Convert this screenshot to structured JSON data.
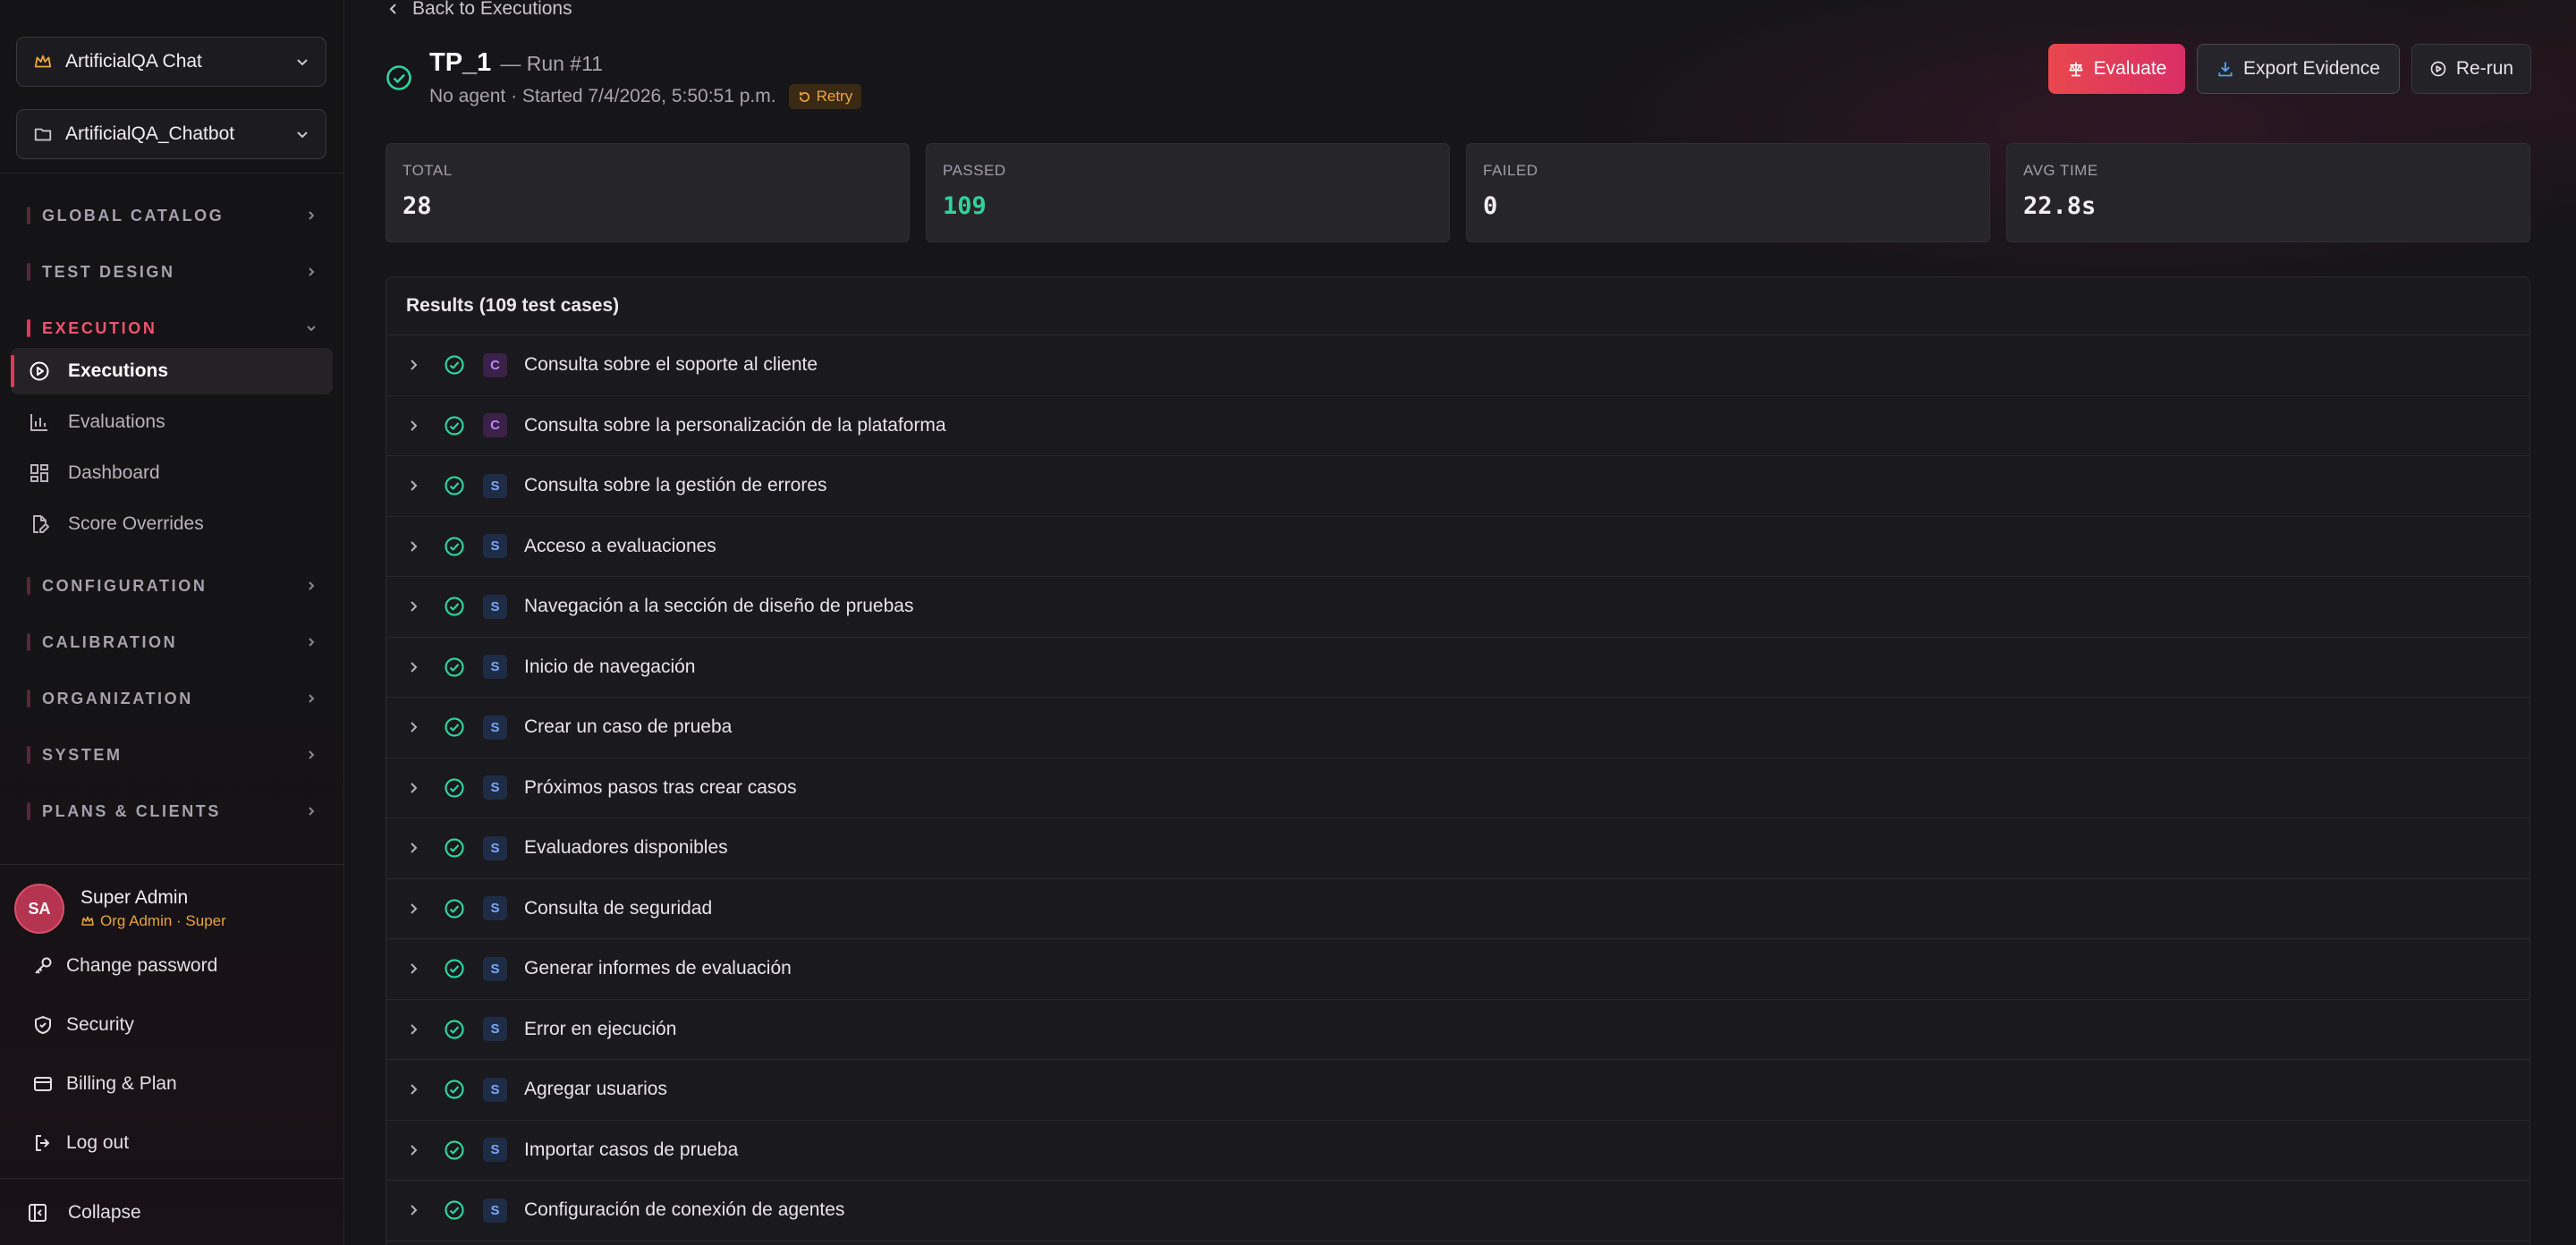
{
  "sidebar": {
    "org_selector": {
      "label": "ArtificialQA Chat",
      "icon": "crown-icon"
    },
    "project_selector": {
      "label": "ArtificialQA_Chatbot",
      "icon": "folder-icon"
    },
    "sections": [
      {
        "label": "GLOBAL CATALOG"
      },
      {
        "label": "TEST DESIGN"
      },
      {
        "label": "EXECUTION"
      },
      {
        "label": "CONFIGURATION"
      },
      {
        "label": "CALIBRATION"
      },
      {
        "label": "ORGANIZATION"
      },
      {
        "label": "SYSTEM"
      },
      {
        "label": "PLANS & CLIENTS"
      }
    ],
    "execution_items": [
      {
        "label": "Executions",
        "icon": "play-circle-icon"
      },
      {
        "label": "Evaluations",
        "icon": "bar-chart-icon"
      },
      {
        "label": "Dashboard",
        "icon": "grid-icon"
      },
      {
        "label": "Score Overrides",
        "icon": "file-edit-icon"
      }
    ],
    "user": {
      "initials": "SA",
      "name": "Super Admin",
      "role": "Org Admin · Super"
    },
    "account_items": [
      {
        "label": "Change password",
        "icon": "key-icon"
      },
      {
        "label": "Security",
        "icon": "shield-icon"
      },
      {
        "label": "Billing & Plan",
        "icon": "credit-card-icon"
      },
      {
        "label": "Log out",
        "icon": "logout-icon"
      }
    ],
    "collapse_label": "Collapse"
  },
  "header": {
    "back_label": "Back to Executions",
    "run_name": "TP_1",
    "run_number": "— Run #11",
    "meta": "No agent · Started 7/4/2026, 5:50:51 p.m.",
    "retry_badge": "Retry",
    "buttons": {
      "evaluate": "Evaluate",
      "export": "Export Evidence",
      "rerun": "Re-run"
    }
  },
  "stats": [
    {
      "label": "TOTAL",
      "value": "28"
    },
    {
      "label": "PASSED",
      "value": "109"
    },
    {
      "label": "FAILED",
      "value": "0"
    },
    {
      "label": "AVG TIME",
      "value": "22.8s"
    }
  ],
  "results": {
    "title": "Results (109 test cases)",
    "rows": [
      {
        "type": "C",
        "label": "Consulta sobre el soporte al cliente"
      },
      {
        "type": "C",
        "label": "Consulta sobre la personalización de la plataforma"
      },
      {
        "type": "S",
        "label": "Consulta sobre la gestión de errores"
      },
      {
        "type": "S",
        "label": "Acceso a evaluaciones"
      },
      {
        "type": "S",
        "label": "Navegación a la sección de diseño de pruebas"
      },
      {
        "type": "S",
        "label": "Inicio de navegación"
      },
      {
        "type": "S",
        "label": "Crear un caso de prueba"
      },
      {
        "type": "S",
        "label": "Próximos pasos tras crear casos"
      },
      {
        "type": "S",
        "label": "Evaluadores disponibles"
      },
      {
        "type": "S",
        "label": "Consulta de seguridad"
      },
      {
        "type": "S",
        "label": "Generar informes de evaluación"
      },
      {
        "type": "S",
        "label": "Error en ejecución"
      },
      {
        "type": "S",
        "label": "Agregar usuarios"
      },
      {
        "type": "S",
        "label": "Importar casos de prueba"
      },
      {
        "type": "S",
        "label": "Configuración de conexión de agentes"
      }
    ]
  },
  "colors": {
    "accent": "#e8355b",
    "success": "#2fd39a",
    "warning": "#efa53c"
  }
}
